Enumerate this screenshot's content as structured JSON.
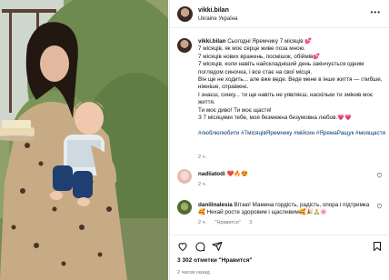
{
  "post": {
    "username": "vikki.bilan",
    "location": "Ukraine Україна"
  },
  "caption": {
    "username": "vikki.bilan",
    "line1": "Сьогодні Яремчику 7 місяців 💕",
    "line2": "7 місяців, як моє серце живе поза мною.",
    "line3": "7 місяців нових вражень, посмішок, обіймів💕",
    "line4": "7 місяців, коли навіть найскладніший день закінчується одним поглядом синочка, і все стає на свої місця.",
    "line5": "Він ще не ходить... але вже веде. Веде мене в інше життя — глибше, ніжніше, справжнє.",
    "line6": "І знаєш, синку... ти ще навіть не уявляєш, наскільки ти змінив моє життя.",
    "line7": "Ти моє диво! Ти моє щастя!",
    "line8": "З 7 місяцями тебе, моя безмежна безумовна любов.💗💗",
    "hashtags": "#люблюлюбити #7місяцівЯремчику #мійсин #ЯремаРащук #моящастя",
    "time": "2 ч."
  },
  "comments": [
    {
      "username": "nadiiatodi",
      "text": "❤️🔥😍",
      "time": "2 ч."
    },
    {
      "username": "danilinalesia",
      "text": "Вітаю! Мамина гордість, радість, опора і підтримка🥰 Нехай росте здоровим і щасливим🥰🎉🙏🌸",
      "time": "2 ч.",
      "reply_label": "\"Нравится\"",
      "reply_count": "3"
    }
  ],
  "footer": {
    "likes": "3 302 отметки \"Нравится\"",
    "time_ago": "2 часов назад"
  },
  "icons": {
    "more": "more-horizontal-icon",
    "heart": "heart-icon",
    "comment": "comment-icon",
    "share": "share-icon",
    "save": "bookmark-icon"
  },
  "colors": {
    "hashtag": "#00376b",
    "muted": "#737373",
    "heart": "#e0245e"
  }
}
